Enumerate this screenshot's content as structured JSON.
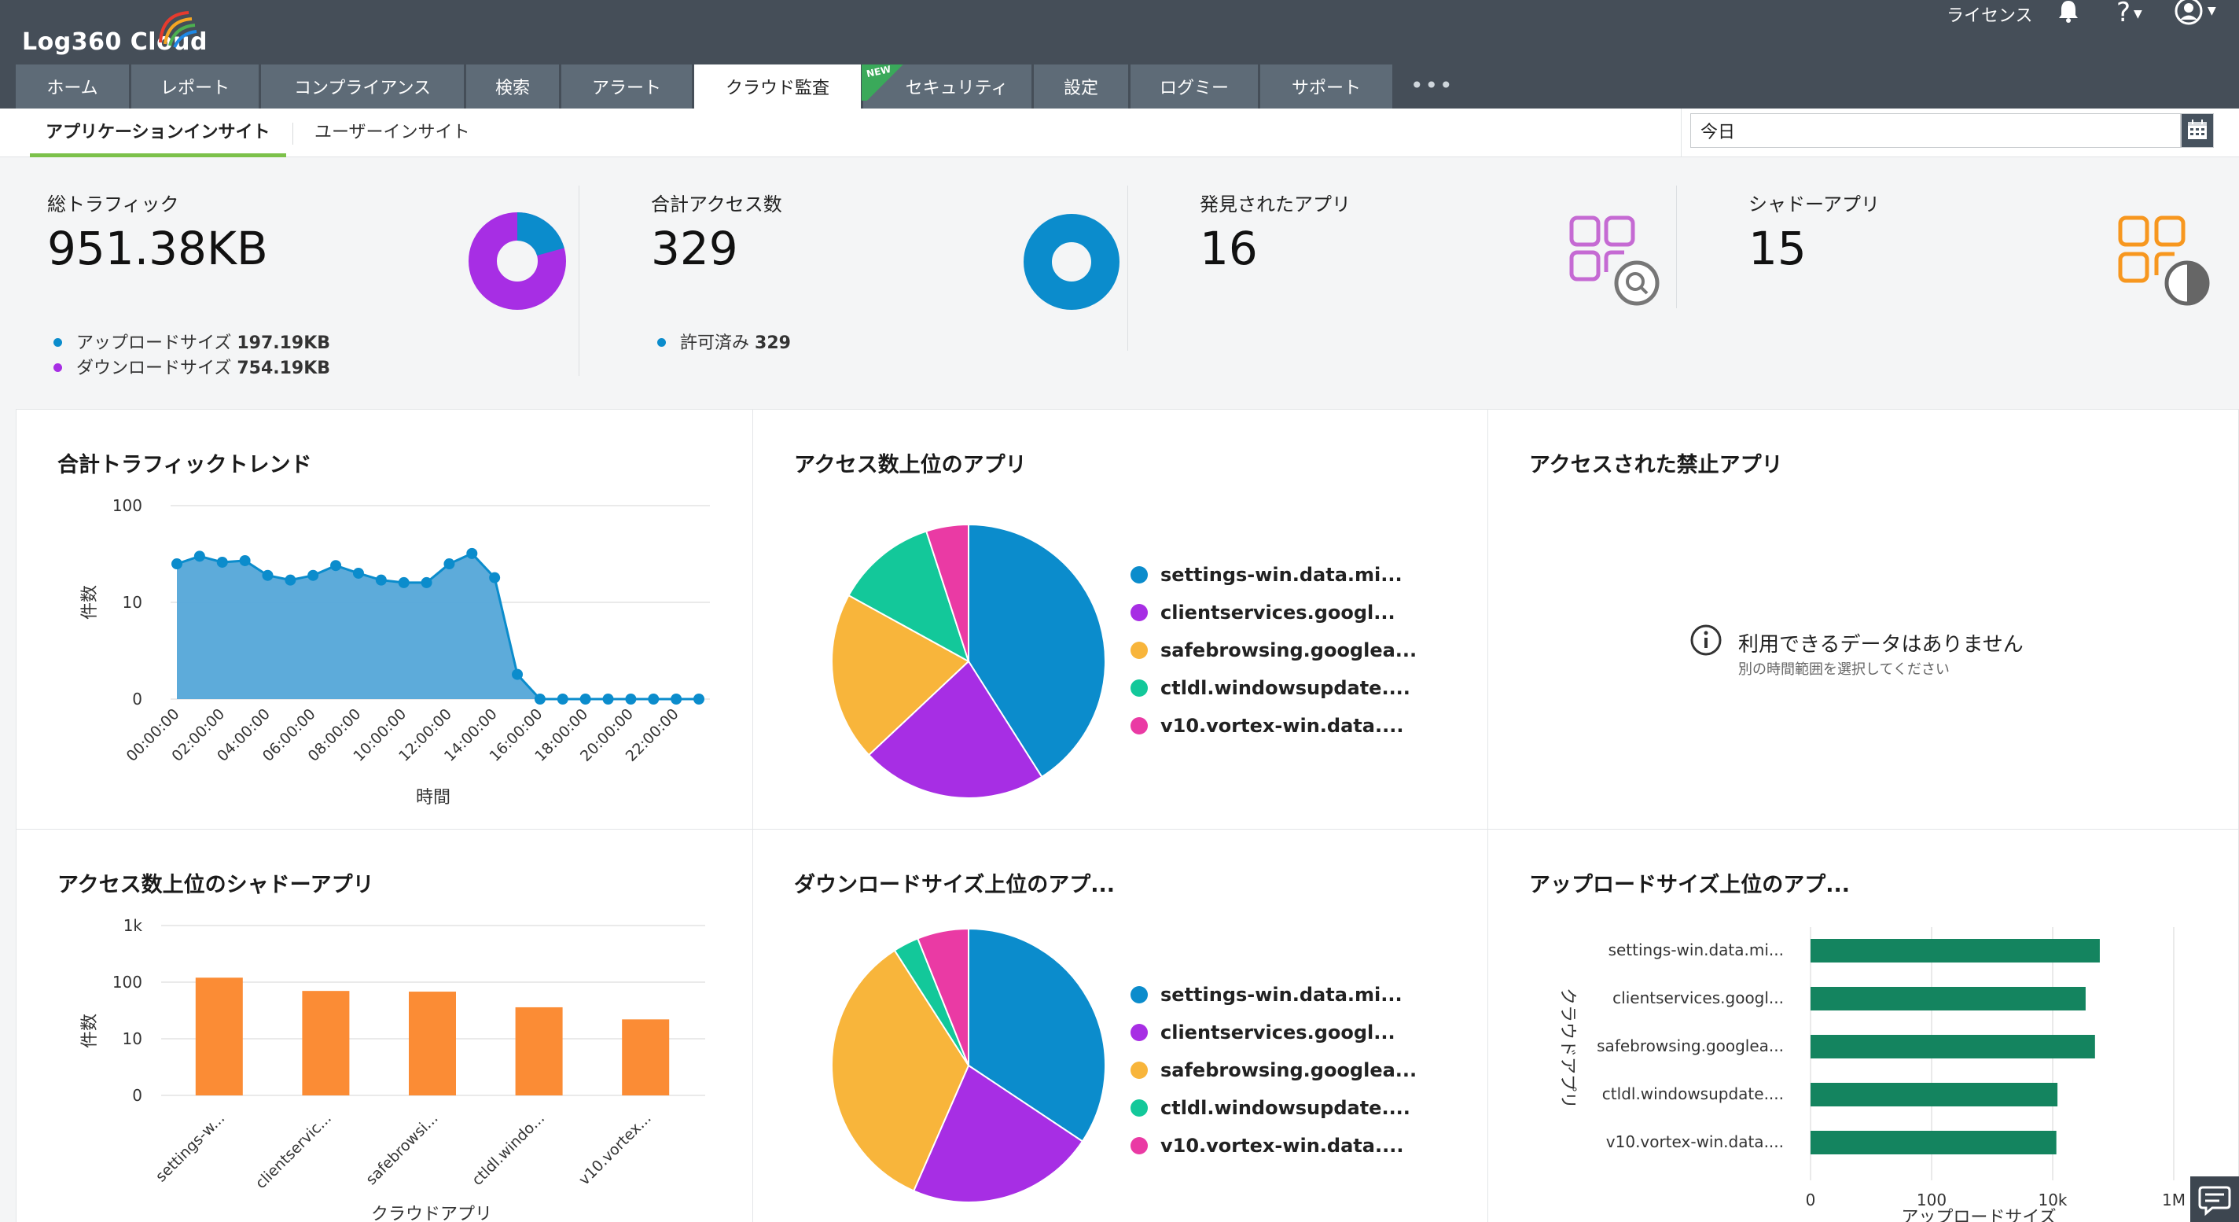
{
  "app": {
    "title": "Log360 Cloud",
    "license": "ライセンス",
    "help": "?"
  },
  "nav": {
    "tabs": [
      "ホーム",
      "レポート",
      "コンプライアンス",
      "検索",
      "アラート",
      "クラウド監査",
      "セキュリティ",
      "設定",
      "ログミー",
      "サポート"
    ],
    "active": "クラウド監査",
    "new_badge": "NEW"
  },
  "subnav": {
    "tabs": [
      "アプリケーションインサイト",
      "ユーザーインサイト"
    ],
    "active": "アプリケーションインサイト"
  },
  "date_range": {
    "value": "今日"
  },
  "summary": {
    "traffic": {
      "title": "総トラフィック",
      "value": "951.38KB",
      "upload_label": "アップロードサイズ",
      "upload_value": "197.19KB",
      "download_label": "ダウンロードサイズ",
      "download_value": "754.19KB"
    },
    "access": {
      "title": "合計アクセス数",
      "value": "329",
      "allowed_label": "許可済み",
      "allowed_value": "329"
    },
    "discovered": {
      "title": "発見されたアプリ",
      "value": "16"
    },
    "shadow": {
      "title": "シャドーアプリ",
      "value": "15"
    }
  },
  "colors": {
    "blue": "#0b8ccc",
    "purple": "#a72ee4",
    "orange": "#f8b53b",
    "green": "#13c89a",
    "pink": "#ea3aa4",
    "bar_orange": "#fb8c35",
    "bar_green": "#14845f",
    "app_icon_purple": "#c56ad3",
    "app_icon_orange": "#f7971f"
  },
  "panels": {
    "traffic_trend": {
      "title": "合計トラフィックトレンド"
    },
    "top_apps": {
      "title": "アクセス数上位のアプリ"
    },
    "banned_apps": {
      "title": "アクセスされた禁止アプリ",
      "empty_message": "利用できるデータはありません",
      "empty_hint": "別の時間範囲を選択してください"
    },
    "top_shadow": {
      "title": "アクセス数上位のシャドーアプリ"
    },
    "download_top": {
      "title": "ダウンロードサイズ上位のアプ..."
    },
    "upload_top": {
      "title": "アップロードサイズ上位のアプ..."
    }
  },
  "chart_data": [
    {
      "type": "area",
      "title": "合計トラフィックトレンド",
      "xlabel": "時間",
      "ylabel": "件数",
      "y_scale": "log",
      "y_ticks": [
        "0",
        "10",
        "100"
      ],
      "x_ticks": [
        "00:00:00",
        "02:00:00",
        "04:00:00",
        "06:00:00",
        "08:00:00",
        "10:00:00",
        "12:00:00",
        "14:00:00",
        "16:00:00",
        "18:00:00",
        "20:00:00",
        "22:00:00"
      ],
      "x": [
        "00:00",
        "01:00",
        "02:00",
        "03:00",
        "04:00",
        "05:00",
        "06:00",
        "07:00",
        "08:00",
        "09:00",
        "10:00",
        "11:00",
        "12:00",
        "13:00",
        "14:00",
        "15:00",
        "16:00",
        "17:00",
        "18:00",
        "19:00",
        "20:00",
        "21:00",
        "22:00",
        "23:00"
      ],
      "values": [
        25,
        30,
        26,
        27,
        19,
        17,
        19,
        24,
        20,
        17,
        16,
        16,
        25,
        32,
        18,
        1.8,
        0,
        0,
        0,
        0,
        0,
        0,
        0,
        0
      ],
      "grid": true
    },
    {
      "type": "pie",
      "title": "アクセス数上位のアプリ",
      "labels": [
        "settings-win.data.mi...",
        "clientservices.googl...",
        "safebrowsing.googlea...",
        "ctldl.windowsupdate....",
        "v10.vortex-win.data...."
      ],
      "values": [
        41,
        22,
        20,
        12,
        5
      ]
    },
    {
      "type": "bar",
      "title": "アクセス数上位のシャドーアプリ",
      "xlabel": "クラウドアプリ",
      "ylabel": "件数",
      "y_scale": "log",
      "y_ticks": [
        "0",
        "10",
        "100",
        "1k"
      ],
      "categories": [
        "settings-w...",
        "clientservic...",
        "safebrowsi...",
        "ctldl.windo...",
        "v10.vortex..."
      ],
      "values": [
        120,
        70,
        68,
        36,
        22
      ]
    },
    {
      "type": "pie",
      "title": "ダウンロードサイズ上位のアプ...",
      "labels": [
        "settings-win.data.mi...",
        "clientservices.googl...",
        "safebrowsing.googlea...",
        "ctldl.windowsupdate....",
        "v10.vortex-win.data...."
      ],
      "values": [
        34,
        22,
        34,
        3,
        6
      ]
    },
    {
      "type": "bar",
      "orientation": "horizontal",
      "title": "アップロードサイズ上位のアプ...",
      "xlabel": "アップロードサイズ",
      "ylabel": "クラウドアプリ",
      "x_scale": "log",
      "x_ticks": [
        "0",
        "100",
        "10k",
        "1M"
      ],
      "categories": [
        "settings-win.data.mi...",
        "clientservices.googl...",
        "safebrowsing.googlea...",
        "ctldl.windowsupdate....",
        "v10.vortex-win.data...."
      ],
      "values": [
        60000,
        35000,
        50000,
        12000,
        11500
      ]
    }
  ]
}
